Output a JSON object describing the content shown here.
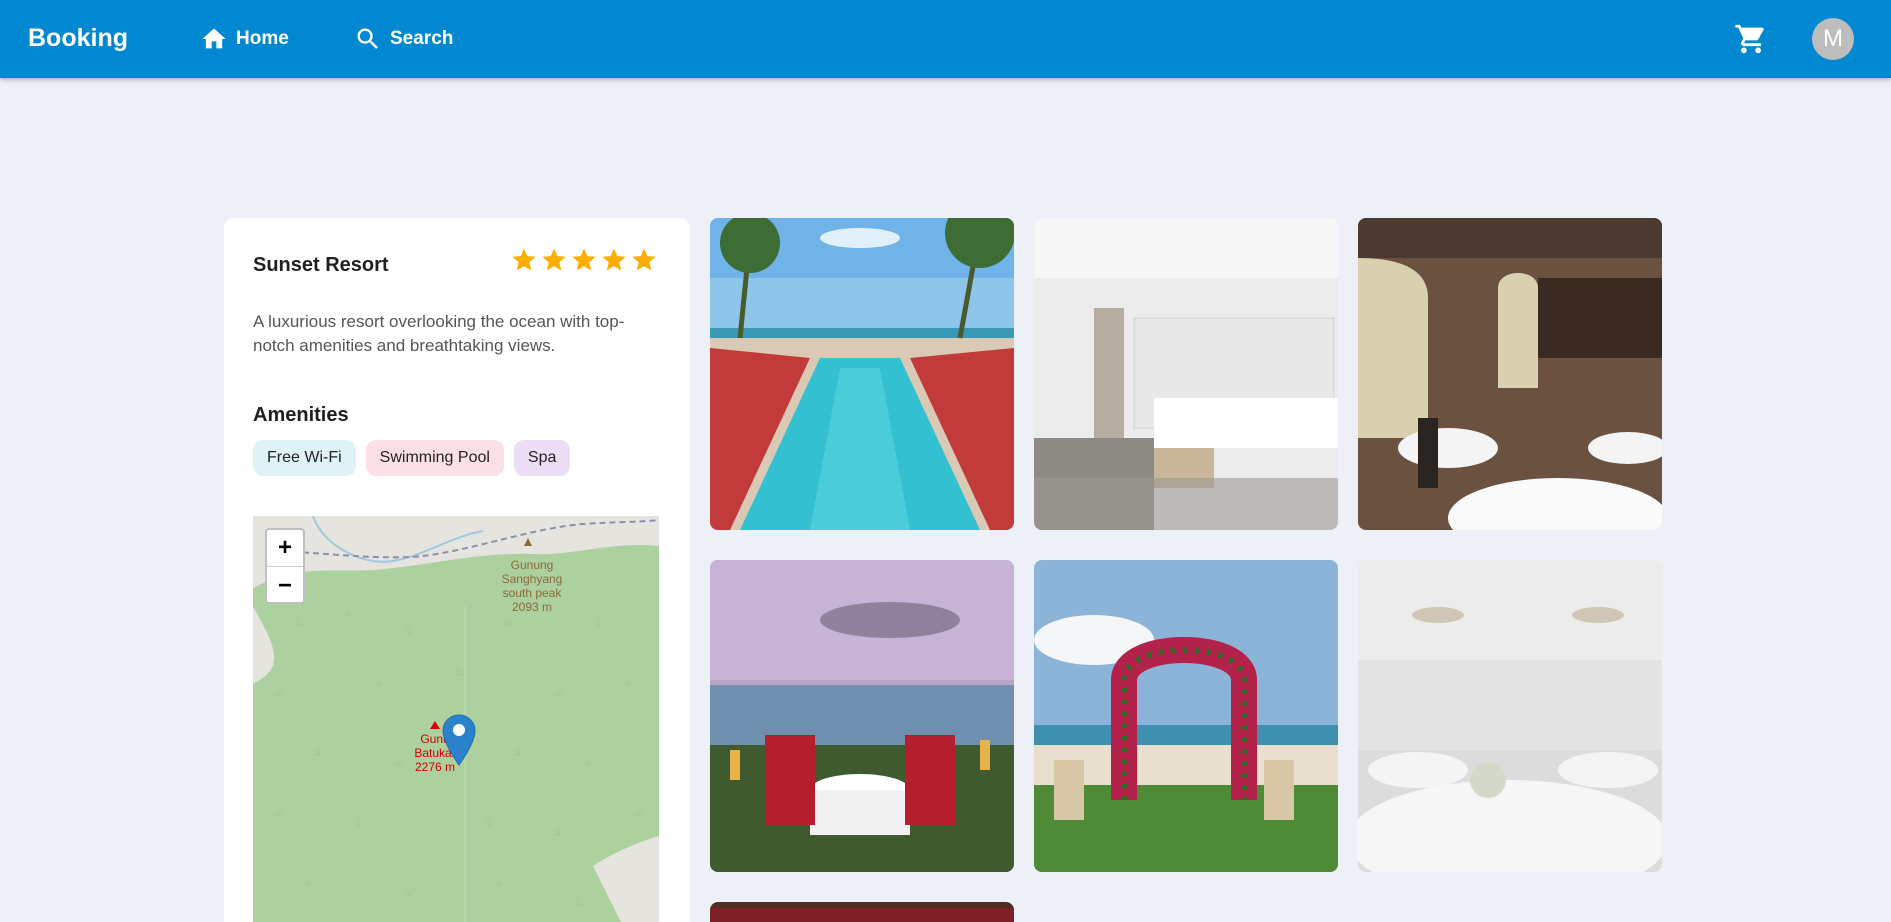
{
  "appbar": {
    "brand": "Booking",
    "nav": [
      {
        "label": "Home",
        "icon": "home-icon"
      },
      {
        "label": "Search",
        "icon": "search-icon"
      }
    ],
    "cart_icon": "cart-icon",
    "avatar_initial": "M",
    "color": "#0288d1"
  },
  "hotel": {
    "name": "Sunset Resort",
    "rating": 5,
    "rating_max": 5,
    "description": "A luxurious resort overlooking the ocean with top-notch amenities and breathtaking views.",
    "amenities_title": "Amenities",
    "amenities": [
      "Free Wi-Fi",
      "Swimming Pool",
      "Spa"
    ]
  },
  "map": {
    "zoom_in": "+",
    "zoom_out": "−",
    "labels": {
      "peak1": [
        "Gunung",
        "Sanghyang",
        "south peak",
        "2093 m"
      ],
      "peak2": [
        "Gunu",
        "Batukar",
        "2276 m"
      ]
    }
  },
  "gallery": [
    {
      "name": "pool"
    },
    {
      "name": "bedroom"
    },
    {
      "name": "restaurant"
    },
    {
      "name": "beach-dinner"
    },
    {
      "name": "wedding-arch"
    },
    {
      "name": "ballroom"
    },
    {
      "name": "garden"
    }
  ]
}
